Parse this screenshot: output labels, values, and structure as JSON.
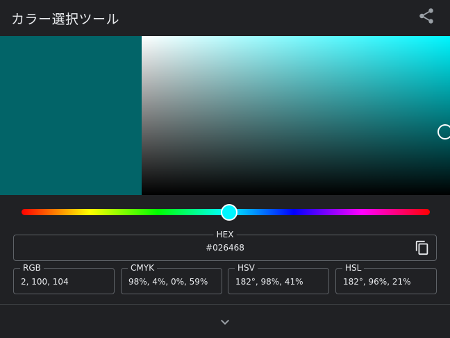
{
  "header": {
    "title": "カラー選択ツール",
    "share_icon": "share-icon"
  },
  "color": {
    "preview_hex": "#026468",
    "hue_color": "#00f6ff",
    "hue_degrees": 182,
    "saturation_percent": 98,
    "value_percent": 41
  },
  "fields": {
    "hex": {
      "label": "HEX",
      "value": "#026468"
    },
    "rgb": {
      "label": "RGB",
      "value": "2, 100, 104"
    },
    "cmyk": {
      "label": "CMYK",
      "value": "98%, 4%, 0%, 59%"
    },
    "hsv": {
      "label": "HSV",
      "value": "182°, 98%, 41%"
    },
    "hsl": {
      "label": "HSL",
      "value": "182°, 96%, 21%"
    }
  },
  "icons": {
    "copy": "copy-icon",
    "expand": "chevron-down-icon"
  }
}
